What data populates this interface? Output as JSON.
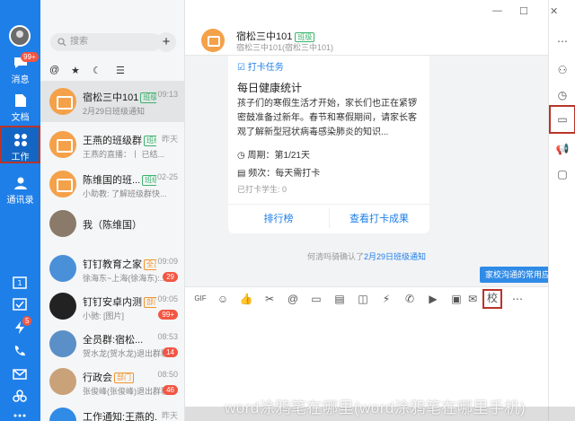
{
  "window": {
    "controls": [
      "—",
      "☐",
      "✕"
    ]
  },
  "rail": {
    "items": [
      {
        "label": "消息",
        "badge": "99+"
      },
      {
        "label": "文档"
      },
      {
        "label": "工作"
      },
      {
        "label": "通讯录"
      }
    ],
    "bottom_badge": "5"
  },
  "list": {
    "search_placeholder": "搜索",
    "add_label": "+",
    "filters": [
      "@",
      "★",
      "☾",
      "☰"
    ],
    "chats": [
      {
        "name": "宿松三中101",
        "tag": "班级",
        "time": "09:13",
        "msg": "2月29日班级通知"
      },
      {
        "name": "王燕的班级群",
        "tag": "班级",
        "time": "昨天",
        "msg": "王燕的直播：丨 已结..."
      },
      {
        "name": "陈维国的班...",
        "tag": "班级",
        "time": "02-25",
        "msg": "小助教: 了解班级群快..."
      },
      {
        "name": "我（陈维国）",
        "tag": "",
        "time": "",
        "msg": ""
      },
      {
        "name": "钉钉教育之家",
        "tag": "全员",
        "time": "09:09",
        "msg": "徐海东~上海(徐海东):...",
        "count": "29"
      },
      {
        "name": "钉钉安卓内测",
        "tag": "部门",
        "time": "09:05",
        "msg": "小驰: [图片]",
        "count": "99+"
      },
      {
        "name": "全员群:宿松...",
        "tag": "",
        "time": "08:53",
        "msg": "贺水龙(贺水龙)退出群聊",
        "count": "14"
      },
      {
        "name": "行政会",
        "tag": "部门",
        "time": "08:50",
        "msg": "张俊峰(张俊峰)退出群聊",
        "count": "46"
      },
      {
        "name": "工作通知:王燕的...",
        "tag": "",
        "time": "昨天",
        "msg": ""
      }
    ]
  },
  "chat": {
    "title": "宿松三中101",
    "title_tag": "班级",
    "subtitle": "宿松三中101(宿松三中101)",
    "card": {
      "task_label": "打卡任务",
      "title": "每日健康统计",
      "body": "孩子们的寒假生活才开始，家长们也正在紧锣密鼓准备过新年。春节和寒假期间，请家长客观了解新型冠状病毒感染肺炎的知识...",
      "cycle": "周期：第1/21天",
      "frequency": "频次：每天需打卡",
      "count": "已打卡学生: 0",
      "btn_rank": "排行榜",
      "btn_result": "查看打卡成果"
    },
    "confirm_prefix": "何清吗骑确认了",
    "confirm_link": "2月29日班级通知",
    "tooltip": "家校沟通的常用应用都在这"
  },
  "toolbar_icons": [
    "gif-icon",
    "emoji-icon",
    "thumb-icon",
    "scissors-icon",
    "at-icon",
    "folder-icon",
    "docs-icon",
    "box-icon",
    "flash-icon",
    "phone-icon",
    "video-icon",
    "image-icon",
    "mail-icon",
    "school-icon",
    "more-icon"
  ],
  "side_icons": [
    "more-icon",
    "add-member-icon",
    "history-icon",
    "folder-icon",
    "notice-icon",
    "live-icon"
  ],
  "watermark": "word涂鸦笔在哪里(word涂鸦笔在哪里手机)"
}
